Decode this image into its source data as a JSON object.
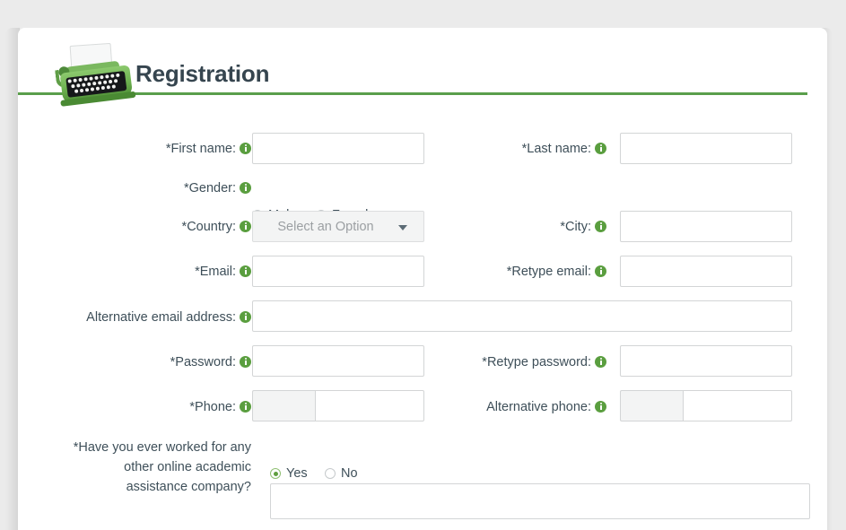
{
  "header": {
    "title": "Registration",
    "logo_icon": "typewriter-icon",
    "accent_color": "#5a9e4b",
    "title_color": "#36454f"
  },
  "colors": {
    "page_background": "#ebebeb",
    "card_background": "#ffffff",
    "label_text": "#3e4f59",
    "info_icon": "#5a9e3f",
    "field_border": "#d3d5d6",
    "placeholder_text": "#9b9fa2",
    "radio_selected": "#5f9e3f",
    "disabled_field": "#f3f4f4"
  },
  "form": {
    "fields": {
      "first_name": {
        "label": "*First name:",
        "value": "",
        "placeholder": ""
      },
      "last_name": {
        "label": "*Last name:",
        "value": "",
        "placeholder": ""
      },
      "gender": {
        "label": "*Gender:",
        "options": [
          "Male",
          "Female"
        ],
        "selected": null
      },
      "country": {
        "label": "*Country:",
        "placeholder": "Select an Option",
        "value": "",
        "selected_text": "Select an Option"
      },
      "city": {
        "label": "*City:",
        "value": "",
        "placeholder": ""
      },
      "email": {
        "label": "*Email:",
        "value": "",
        "placeholder": ""
      },
      "retype_email": {
        "label": "*Retype email:",
        "value": "",
        "placeholder": ""
      },
      "alternative_email": {
        "label": "Alternative email address:",
        "value": "",
        "placeholder": ""
      },
      "password": {
        "label": "*Password:",
        "value": "",
        "placeholder": ""
      },
      "retype_password": {
        "label": "*Retype password:",
        "value": "",
        "placeholder": ""
      },
      "phone": {
        "label": "*Phone:",
        "prefix": "",
        "value": "",
        "placeholder": ""
      },
      "alternative_phone": {
        "label": "Alternative phone:",
        "prefix": "",
        "value": "",
        "placeholder": ""
      },
      "worked_before": {
        "label": "*Have you ever worked for any other online academic assistance company?",
        "label_line1": "*Have you ever worked for any",
        "label_line2": "other online academic",
        "label_line3": "assistance company?",
        "options": [
          "Yes",
          "No"
        ],
        "selected": "Yes",
        "detail_value": "",
        "detail_placeholder": ""
      }
    },
    "info_icon_name": "info-icon"
  }
}
